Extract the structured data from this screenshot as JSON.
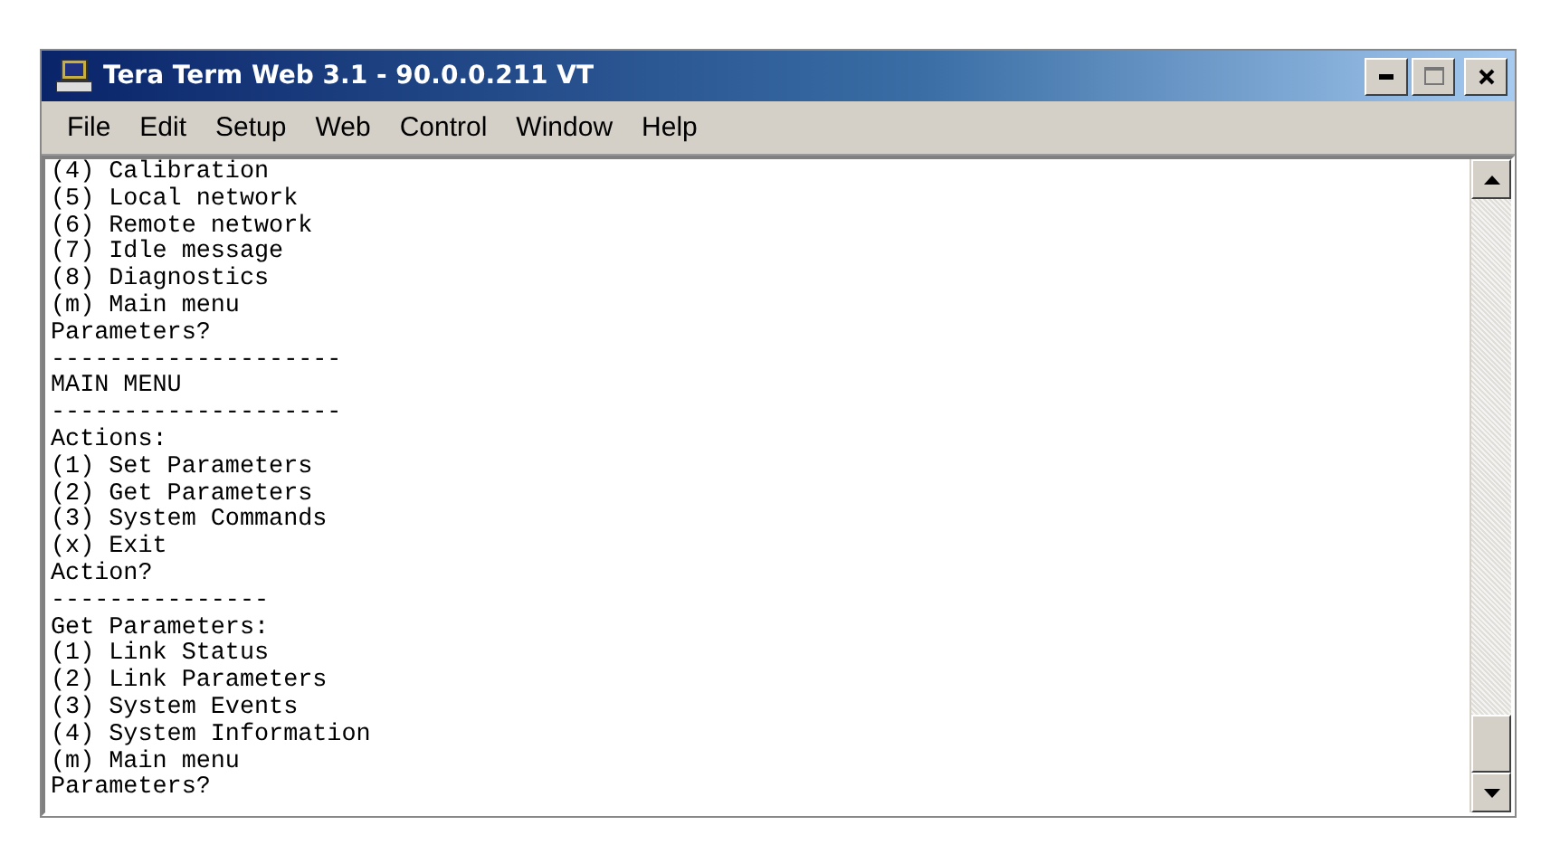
{
  "window": {
    "title": "Tera Term Web 3.1 - 90.0.0.211 VT"
  },
  "menu": [
    "File",
    "Edit",
    "Setup",
    "Web",
    "Control",
    "Window",
    "Help"
  ],
  "terminal": {
    "lines": [
      "(4) Calibration",
      "(5) Local network",
      "(6) Remote network",
      "(7) Idle message",
      "(8) Diagnostics",
      "(m) Main menu",
      "Parameters?",
      "--------------------",
      "MAIN MENU",
      "--------------------",
      "Actions:",
      "(1) Set Parameters",
      "(2) Get Parameters",
      "(3) System Commands",
      "(x) Exit",
      "Action?",
      "---------------",
      "Get Parameters:",
      "(1) Link Status",
      "(2) Link Parameters",
      "(3) System Events",
      "(4) System Information",
      "(m) Main menu",
      "Parameters?"
    ]
  }
}
